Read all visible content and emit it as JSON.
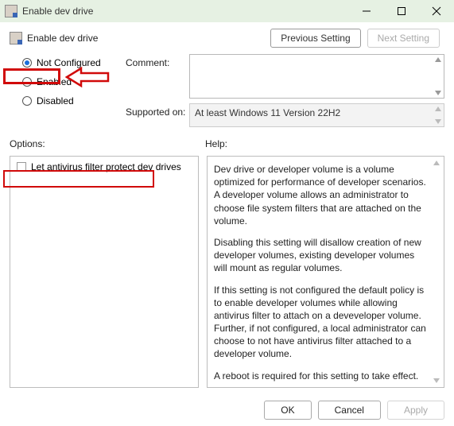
{
  "window": {
    "title": "Enable dev drive"
  },
  "header": {
    "title": "Enable dev drive",
    "prev": "Previous Setting",
    "next": "Next Setting"
  },
  "radios": {
    "not_configured": "Not Configured",
    "enabled": "Enabled",
    "disabled": "Disabled",
    "selected": "not_configured"
  },
  "fields": {
    "comment_label": "Comment:",
    "supported_label": "Supported on:",
    "supported_value": "At least Windows 11 Version 22H2"
  },
  "sections": {
    "options_label": "Options:",
    "help_label": "Help:"
  },
  "options": {
    "antivirus_label": "Let antivirus filter protect dev drives"
  },
  "help": {
    "p1": "Dev drive or developer volume is a volume optimized for performance of developer scenarios. A developer volume allows an administrator to choose file system filters that are attached on the volume.",
    "p2": "Disabling this setting will disallow creation of new developer volumes, existing developer volumes will mount as regular volumes.",
    "p3": "If this setting is not configured the default policy is to enable developer volumes while allowing antivirus filter to attach on a deveveloper volume.  Further, if not configured, a local administrator can choose to not have antivirus filter attached to a developer volume.",
    "p4": "A reboot is required for this setting to take effect."
  },
  "footer": {
    "ok": "OK",
    "cancel": "Cancel",
    "apply": "Apply"
  }
}
